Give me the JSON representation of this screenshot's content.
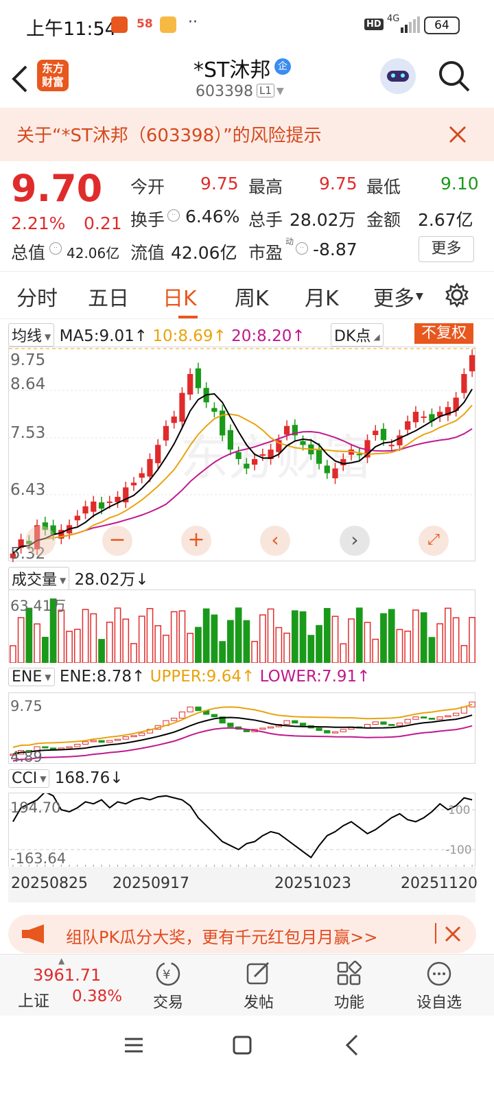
{
  "status_bar": {
    "time": "上午11:54",
    "icons": [
      "fire-app-icon",
      "58-app-icon",
      "notes-app-icon",
      "more-dots-icon"
    ],
    "hd": "HD",
    "net": "4G",
    "battery": "64"
  },
  "header": {
    "back": "back-arrow-icon",
    "logo_text_1": "东方",
    "logo_text_2": "财富",
    "stock_name": "*ST沐邦",
    "badge": "企",
    "code": "603398",
    "level": "L1"
  },
  "risk_banner": {
    "text": "关于“*ST沐邦（603398）”的风险提示"
  },
  "quote": {
    "price": "9.70",
    "change_pct": "2.21%",
    "change": "0.21",
    "open_label": "今开",
    "open": "9.75",
    "high_label": "最高",
    "high": "9.75",
    "low_label": "最低",
    "low": "9.10",
    "turnover_label": "换手",
    "turnover": "6.46%",
    "volume_label": "总手",
    "volume": "28.02万",
    "amount_label": "金额",
    "amount": "2.67亿",
    "mcap_label": "总值",
    "mcap": "42.06亿",
    "float_label": "流值",
    "float": "42.06亿",
    "pe_label": "市盈",
    "pe_sup": "动",
    "pe": "-8.87",
    "more": "更多"
  },
  "tabs": {
    "t1": "分时",
    "t2": "五日",
    "t3": "日K",
    "t4": "周K",
    "t5": "月K",
    "t6": "更多"
  },
  "kline": {
    "ma_dd": "均线",
    "ma5": "MA5:9.01",
    "ma10": "10:8.69",
    "ma20": "20:8.20",
    "dk": "DK点",
    "fq": "不复权",
    "y1": "9.75",
    "y2": "8.64",
    "y3": "7.53",
    "y4": "6.43",
    "y5": "5.32",
    "watermark": "东方财富"
  },
  "volume": {
    "dd": "成交量",
    "value": "28.02万",
    "y1": "63.41万"
  },
  "ene": {
    "dd": "ENE",
    "ene": "ENE:8.78",
    "upper": "UPPER:9.64",
    "lower": "LOWER:7.91",
    "y1": "9.75",
    "y2": "4.89"
  },
  "cci": {
    "dd": "CCI",
    "value": "168.76",
    "y1": "194.70",
    "y2": "-163.64",
    "r1": "100",
    "r2": "-100"
  },
  "dates": {
    "d1": "20250825",
    "d2": "20250917",
    "d3": "20251023",
    "d4": "20251120"
  },
  "promo": {
    "text": "组队PK瓜分大奖，更有千元红包月月赢>>"
  },
  "bottom_bar": {
    "index_value": "3961.71",
    "index_name": "上证",
    "index_pct": "0.38%",
    "b1": "交易",
    "b2": "发帖",
    "b3": "功能",
    "b4": "设自选"
  },
  "colors": {
    "up": "#e02b2b",
    "down": "#1a9a1a",
    "accent": "#e8571e",
    "ma5": "#000000",
    "ma10": "#e8a30c",
    "ma20": "#c0188c"
  }
}
